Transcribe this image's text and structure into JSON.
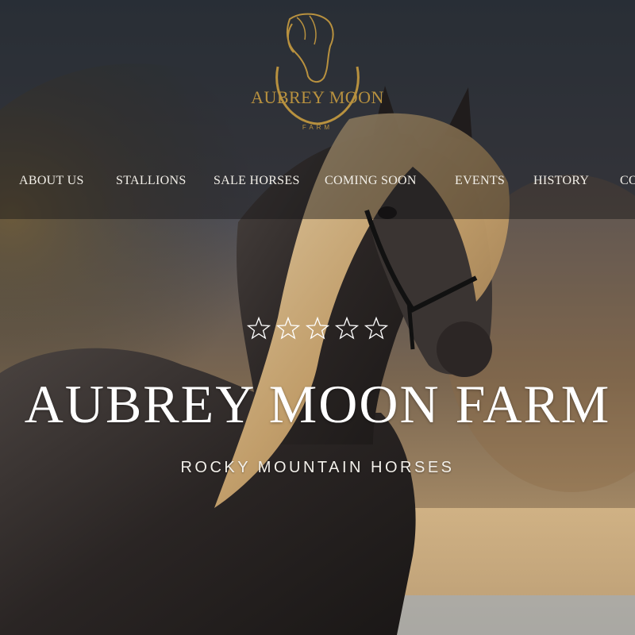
{
  "site": {
    "logo_text": "AUBREY MOON",
    "logo_sub": "FARM",
    "accent": "#b8913f"
  },
  "nav": {
    "items": [
      {
        "label": "ABOUT US"
      },
      {
        "label": "STALLIONS"
      },
      {
        "label": "SALE HORSES"
      },
      {
        "label": "COMING SOON"
      },
      {
        "label": "EVENTS"
      },
      {
        "label": "HISTORY"
      },
      {
        "label": "CO"
      }
    ]
  },
  "hero": {
    "stars_icon": "star-outline-icon",
    "title": "AUBREY MOON FARM",
    "subtitle": "ROCKY MOUNTAIN HORSES",
    "image": "black-horse-with-flaxen-mane-photo"
  }
}
